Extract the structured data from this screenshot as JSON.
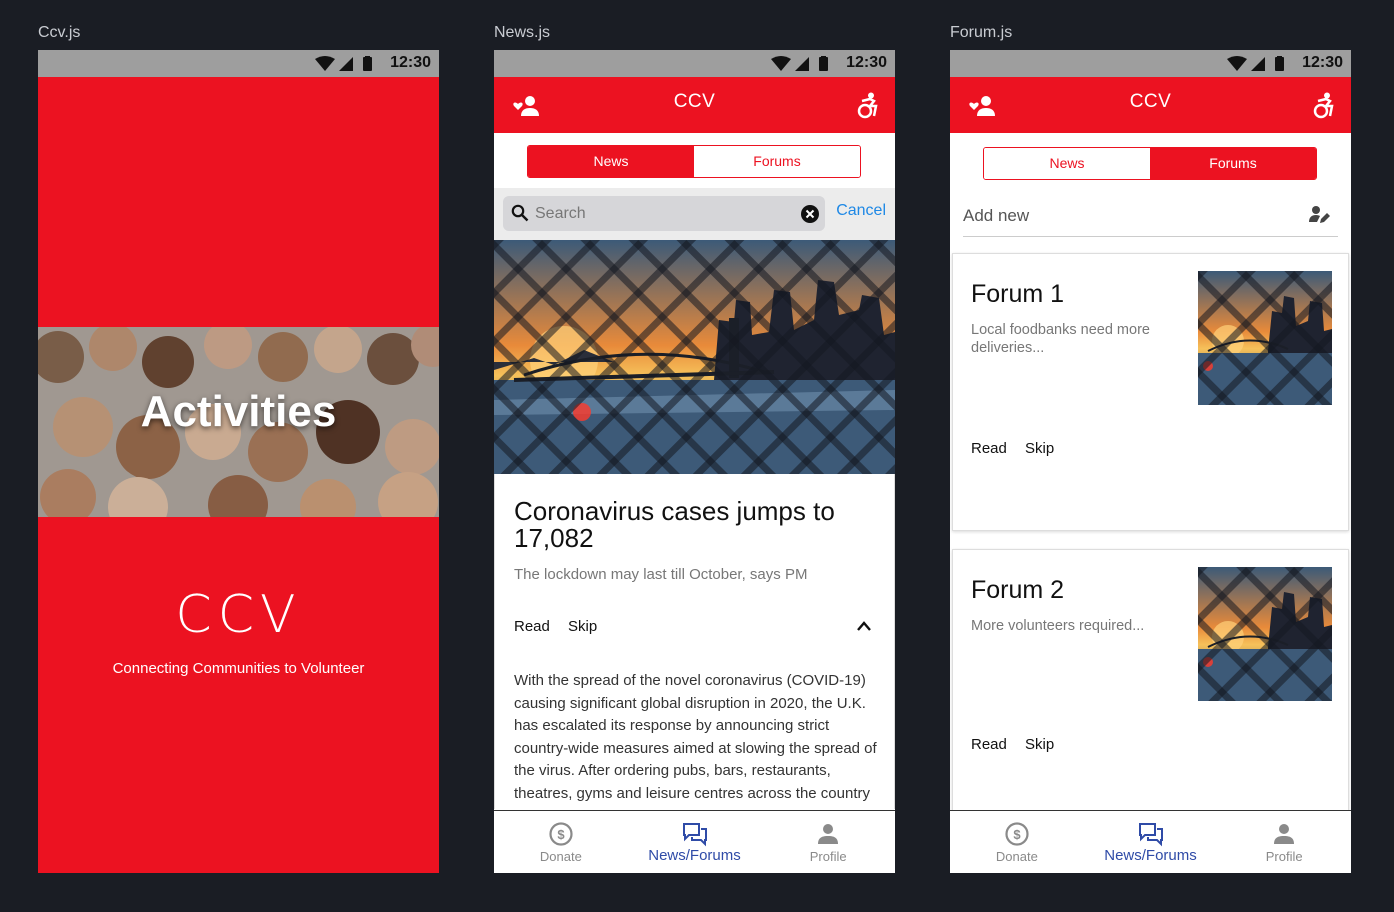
{
  "screens": {
    "splash": {
      "label": "Ccv.js",
      "time": "12:30",
      "banner_title": "Activities",
      "logo": "CCV",
      "tagline": "Connecting Communities to Volunteer"
    },
    "news": {
      "label": "News.js",
      "time": "12:30",
      "app_title": "CCV",
      "tabs": {
        "news": "News",
        "forums": "Forums",
        "active": "news"
      },
      "search": {
        "placeholder": "Search",
        "cancel": "Cancel"
      },
      "article": {
        "title": "Coronavirus cases jumps to 17,082",
        "subtitle": "The lockdown may last till October, says PM",
        "read": "Read",
        "skip": "Skip",
        "body": "With the spread of the novel coronavirus (COVID-19) causing significant global disruption in 2020, the U.K. has escalated its response by announcing strict country-wide measures aimed at slowing the spread of the virus. After ordering pubs, bars, restaurants, theatres, gyms and leisure centres across the country to close indefinitely, Prime Minister Boris"
      },
      "bottom_nav": {
        "donate": "Donate",
        "news_forums": "News/Forums",
        "profile": "Profile"
      }
    },
    "forum": {
      "label": "Forum.js",
      "time": "12:30",
      "app_title": "CCV",
      "tabs": {
        "news": "News",
        "forums": "Forums",
        "active": "forums"
      },
      "add_new": "Add new",
      "forums": [
        {
          "title": "Forum 1",
          "description": "Local foodbanks need more deliveries...",
          "read": "Read",
          "skip": "Skip"
        },
        {
          "title": "Forum 2",
          "description": "More volunteers required...",
          "read": "Read",
          "skip": "Skip"
        }
      ],
      "bottom_nav": {
        "donate": "Donate",
        "news_forums": "News/Forums",
        "profile": "Profile"
      }
    }
  },
  "colors": {
    "brand_red": "#ec1221",
    "nav_active": "#2f4ba7",
    "link_blue": "#1e88e5",
    "background": "#1a1d24"
  },
  "icons": [
    "wifi-icon",
    "signal-icon",
    "battery-icon",
    "volunteer-icon",
    "accessibility-icon",
    "search-icon",
    "clear-icon",
    "chevron-up-icon",
    "edit-user-icon",
    "dollar-icon",
    "forum-icon",
    "person-icon"
  ]
}
